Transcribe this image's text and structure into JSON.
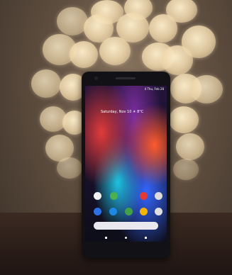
{
  "phone": {
    "status_time": "4 Thu, Feb 28",
    "home_date": "Saturday, Nov 10 ☀ 8°C"
  },
  "icons": [
    "gmail-icon",
    "maps-icon",
    "youtube-icon",
    "chrome-icon",
    "phone-icon",
    "messages-icon",
    "play-store-icon",
    "camera-icon"
  ],
  "colors": {
    "bokeh": "#f2dcae",
    "background": "#5a4a3c",
    "phone_body": "#121216"
  }
}
